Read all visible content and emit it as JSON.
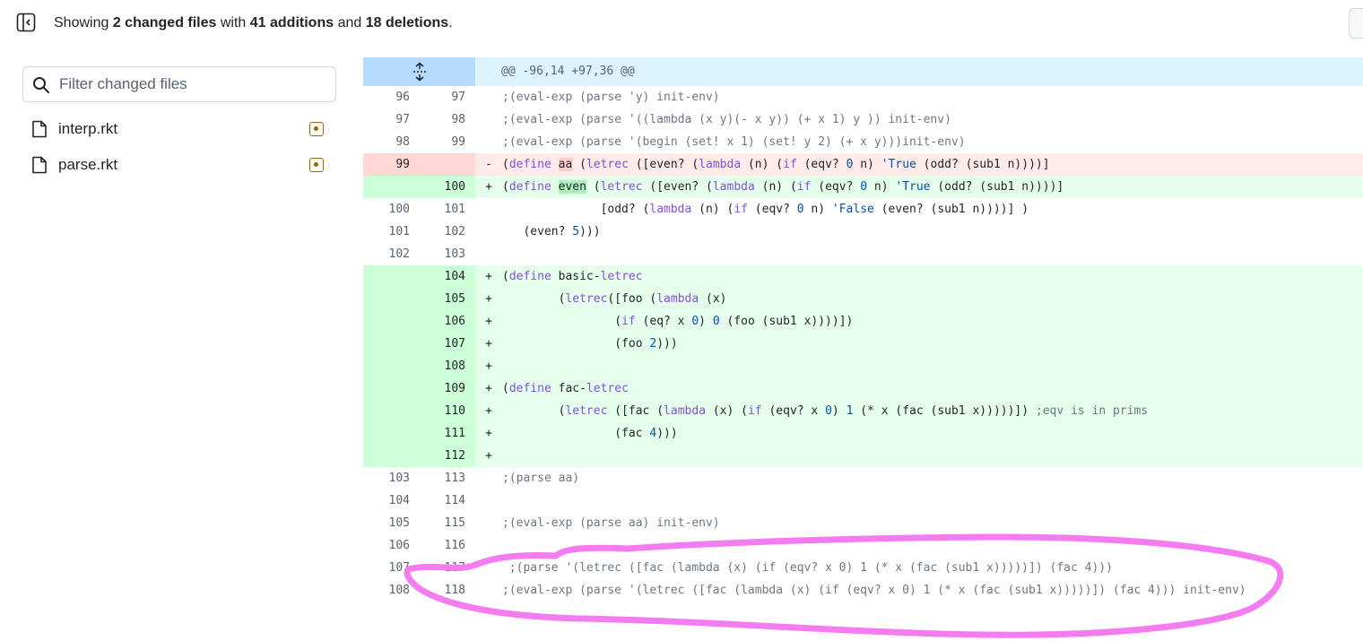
{
  "header": {
    "summary_prefix": "Showing ",
    "changed_files": "2 changed files",
    "summary_with": " with ",
    "additions": "41 additions",
    "summary_and": " and ",
    "deletions": "18 deletions",
    "summary_end": "."
  },
  "filter": {
    "placeholder": "Filter changed files"
  },
  "files": [
    {
      "name": "interp.rkt"
    },
    {
      "name": "parse.rkt"
    }
  ],
  "hunk": {
    "header": "@@ -96,14 +97,36 @@"
  },
  "lines": [
    {
      "type": "ctx",
      "old": "96",
      "new": "97",
      "marker": "",
      "code": ";(eval-exp (parse 'y) init-env)"
    },
    {
      "type": "ctx",
      "old": "97",
      "new": "98",
      "marker": "",
      "code": ";(eval-exp (parse '((lambda (x y)(- x y)) (+ x 1) y )) init-env)"
    },
    {
      "type": "ctx",
      "old": "98",
      "new": "99",
      "marker": "",
      "code": ";(eval-exp (parse '(begin (set! x 1) (set! y 2) (+ x y)))init-env)"
    },
    {
      "type": "del",
      "old": "99",
      "new": "",
      "marker": "-",
      "code": "(define aa (letrec ([even? (lambda (n) (if (eqv? 0 n) 'True (odd? (sub1 n))))]"
    },
    {
      "type": "add",
      "old": "",
      "new": "100",
      "marker": "+",
      "code": "(define even (letrec ([even? (lambda (n) (if (eqv? 0 n) 'True (odd? (sub1 n))))]"
    },
    {
      "type": "plain",
      "old": "100",
      "new": "101",
      "marker": "",
      "code": "              [odd? (lambda (n) (if (eqv? 0 n) 'False (even? (sub1 n))))] )"
    },
    {
      "type": "plain",
      "old": "101",
      "new": "102",
      "marker": "",
      "code": "   (even? 5)))"
    },
    {
      "type": "plain",
      "old": "102",
      "new": "103",
      "marker": "",
      "code": ""
    },
    {
      "type": "add",
      "old": "",
      "new": "104",
      "marker": "+",
      "code": "(define basic-letrec"
    },
    {
      "type": "add",
      "old": "",
      "new": "105",
      "marker": "+",
      "code": "        (letrec([foo (lambda (x)"
    },
    {
      "type": "add",
      "old": "",
      "new": "106",
      "marker": "+",
      "code": "                (if (eq? x 0) 0 (foo (sub1 x))))])"
    },
    {
      "type": "add",
      "old": "",
      "new": "107",
      "marker": "+",
      "code": "                (foo 2)))"
    },
    {
      "type": "add",
      "old": "",
      "new": "108",
      "marker": "+",
      "code": ""
    },
    {
      "type": "add",
      "old": "",
      "new": "109",
      "marker": "+",
      "code": "(define fac-letrec"
    },
    {
      "type": "add",
      "old": "",
      "new": "110",
      "marker": "+",
      "code": "        (letrec ([fac (lambda (x) (if (eqv? x 0) 1 (* x (fac (sub1 x)))))]) ;eqv is in prims"
    },
    {
      "type": "add",
      "old": "",
      "new": "111",
      "marker": "+",
      "code": "                (fac 4)))"
    },
    {
      "type": "add",
      "old": "",
      "new": "112",
      "marker": "+",
      "code": ""
    },
    {
      "type": "ctx",
      "old": "103",
      "new": "113",
      "marker": "",
      "code": ";(parse aa)"
    },
    {
      "type": "ctx",
      "old": "104",
      "new": "114",
      "marker": "",
      "code": ""
    },
    {
      "type": "ctx",
      "old": "105",
      "new": "115",
      "marker": "",
      "code": ";(eval-exp (parse aa) init-env)"
    },
    {
      "type": "ctx",
      "old": "106",
      "new": "116",
      "marker": "",
      "code": ""
    },
    {
      "type": "ctx",
      "old": "107",
      "new": "117",
      "marker": "",
      "code": " ;(parse '(letrec ([fac (lambda (x) (if (eqv? x 0) 1 (* x (fac (sub1 x)))))]) (fac 4)))"
    },
    {
      "type": "ctx",
      "old": "108",
      "new": "118",
      "marker": "",
      "code": ";(eval-exp (parse '(letrec ([fac (lambda (x) (if (eqv? x 0) 1 (* x (fac (sub1 x)))))]) (fac 4))) init-env)"
    }
  ],
  "colors": {
    "annotation": "#f47cf0",
    "addition_bg": "#e6ffec",
    "deletion_bg": "#ffebe9",
    "hunk_bg": "#ddf4ff"
  }
}
